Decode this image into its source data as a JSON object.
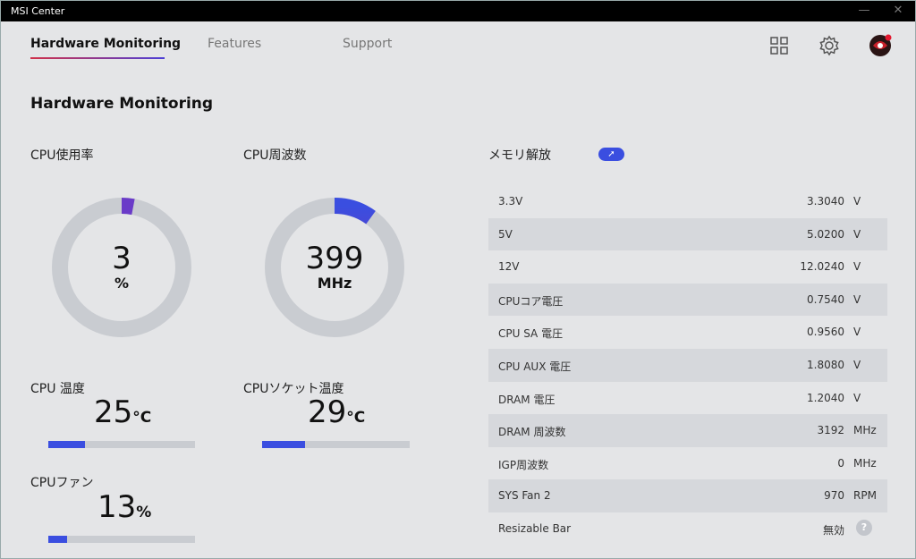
{
  "app": {
    "title": "MSI Center",
    "minimize_icon": "—",
    "close_icon": "✕"
  },
  "tabs": [
    {
      "label": "Hardware Monitoring"
    },
    {
      "label": "Features"
    },
    {
      "label": "Support"
    }
  ],
  "page_title": "Hardware Monitoring",
  "cpu_usage": {
    "label": "CPU使用率",
    "value": "3",
    "unit": "%",
    "fraction": 0.03
  },
  "cpu_freq": {
    "label": "CPU周波数",
    "value": "399",
    "unit": "MHz",
    "fraction": 0.1
  },
  "cpu_temp": {
    "label": "CPU 温度",
    "value": "25",
    "unit": "°C",
    "fraction": 0.25
  },
  "socket_temp": {
    "label": "CPUソケット温度",
    "value": "29",
    "unit": "°C",
    "fraction": 0.29
  },
  "cpu_fan": {
    "label": "CPUファン",
    "value": "13",
    "unit": "%",
    "fraction": 0.13
  },
  "memory_release": {
    "label": "メモリ解放",
    "button_icon": "➚"
  },
  "accent_color": "#3a4ee0",
  "sensors": [
    {
      "label": "3.3V",
      "value": "3.3040",
      "unit": "V"
    },
    {
      "label": "5V",
      "value": "5.0200",
      "unit": "V"
    },
    {
      "label": "12V",
      "value": "12.0240",
      "unit": "V"
    },
    {
      "label": "CPUコア電圧",
      "value": "0.7540",
      "unit": "V"
    },
    {
      "label": "CPU SA 電圧",
      "value": "0.9560",
      "unit": "V"
    },
    {
      "label": "CPU AUX 電圧",
      "value": "1.8080",
      "unit": "V"
    },
    {
      "label": "DRAM 電圧",
      "value": "1.2040",
      "unit": "V"
    },
    {
      "label": "DRAM 周波数",
      "value": "3192",
      "unit": "MHz"
    },
    {
      "label": "IGP周波数",
      "value": "0",
      "unit": "MHz"
    },
    {
      "label": "SYS Fan 2",
      "value": "970",
      "unit": "RPM"
    },
    {
      "label": "Resizable Bar",
      "value": "無効",
      "unit": ""
    }
  ],
  "help_icon": "?"
}
